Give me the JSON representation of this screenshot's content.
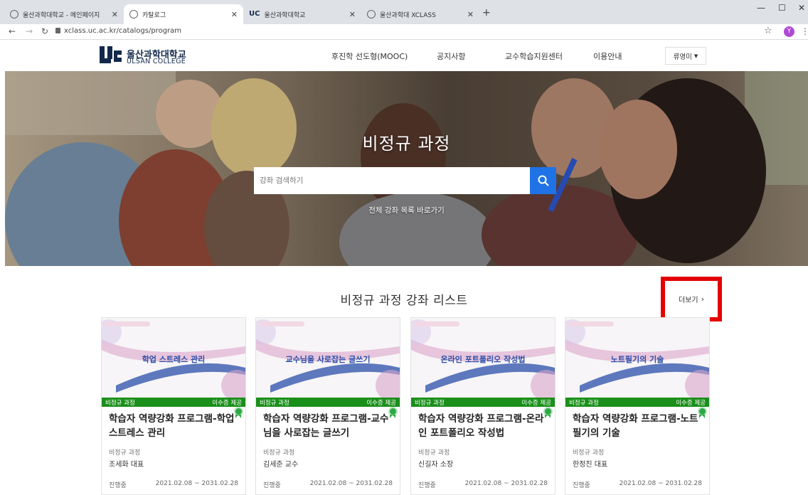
{
  "browser": {
    "tabs": [
      {
        "title": "울산과학대학교 - 메인페이지"
      },
      {
        "title": "카탈로그"
      },
      {
        "title": "울산과학대학교"
      },
      {
        "title": "울산과학대 XCLASS"
      }
    ],
    "url": "xclass.uc.ac.kr/catalogs/program",
    "profile_initial": "Y"
  },
  "site": {
    "logo_ko": "울산과학대학교",
    "logo_en": "ULSAN COLLEGE",
    "menu": [
      {
        "label": "후진학 선도형(MOOC)"
      },
      {
        "label": "공지사항"
      },
      {
        "label": "교수학습지원센터"
      },
      {
        "label": "이용안내"
      }
    ],
    "user_name": "류영미"
  },
  "hero": {
    "title": "비정규 과정",
    "search_placeholder": "강좌 검색하기",
    "link_text": "전체 강좌 목록 바로가기"
  },
  "section": {
    "title": "비정규 과정 강좌 리스트",
    "more_label": "더보기"
  },
  "courses": [
    {
      "thumb_text": "학업 스트레스 관리",
      "category_tag": "비정규 과정",
      "cert_tag": "이수증 제공",
      "title": "학습자 역량강화 프로그램-학업 스트레스 관리",
      "category": "비정규 과정",
      "instructor": "조세화 대표",
      "status": "진행중",
      "period": "2021.02.08 ~ 2031.02.28"
    },
    {
      "thumb_text": "교수님을 사로잡는 글쓰기",
      "category_tag": "비정규 과정",
      "cert_tag": "이수증 제공",
      "title": "학습자 역량강화 프로그램-교수님을 사로잡는 글쓰기",
      "category": "비정규 과정",
      "instructor": "김세준 교수",
      "status": "진행중",
      "period": "2021.02.08 ~ 2031.02.28"
    },
    {
      "thumb_text": "온라인 포트폴리오 작성법",
      "category_tag": "비정규 과정",
      "cert_tag": "이수증 제공",
      "title": "학습자 역량강화 프로그램-온라인 포트폴리오 작성법",
      "category": "비정규 과정",
      "instructor": "신길자 소장",
      "status": "진행중",
      "period": "2021.02.08 ~ 2031.02.28"
    },
    {
      "thumb_text": "노트필기의 기술",
      "category_tag": "비정규 과정",
      "cert_tag": "이수증 제공",
      "title": "학습자 역량강화 프로그램-노트필기의 기술",
      "category": "비정규 과정",
      "instructor": "한정진 대표",
      "status": "진행중",
      "period": "2021.02.08 ~ 2031.02.28"
    }
  ],
  "colors": {
    "accent": "#1f73e6",
    "tag_green": "#1a8f1a",
    "highlight": "#e50000",
    "brand": "#13294b"
  }
}
